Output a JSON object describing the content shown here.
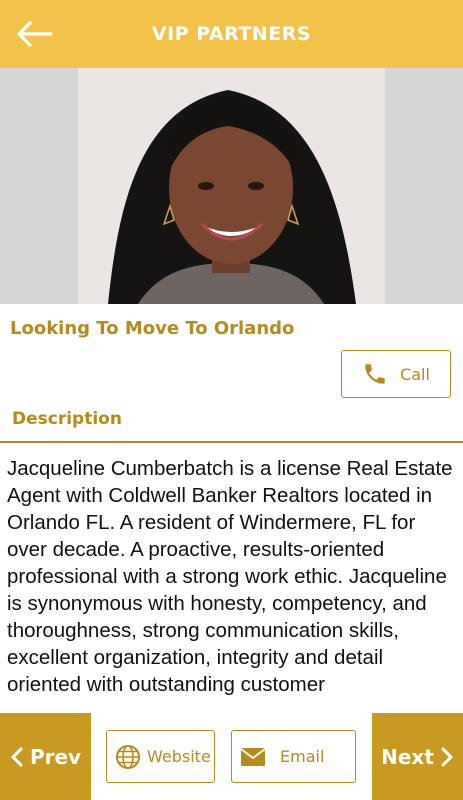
{
  "header": {
    "title": "VIP PARTNERS",
    "back_icon": "arrow-left-icon"
  },
  "profile": {
    "photo_alt": "Partner photo"
  },
  "listing": {
    "title": "Looking To Move To Orlando",
    "call_label": "Call",
    "call_icon": "phone-icon"
  },
  "description": {
    "heading": "Description",
    "text": "Jacqueline Cumberbatch is a license Real Estate Agent with Coldwell Banker Realtors located in Orlando FL.  A resident of Windermere, FL for over decade. A proactive, results-oriented professional with a strong work ethic. Jacqueline is synonymous with honesty, competency, and thoroughness, strong communication skills, excellent organization, integrity and detail oriented with outstanding customer"
  },
  "bottom_nav": {
    "prev_label": "Prev",
    "next_label": "Next",
    "website_label": "Website",
    "email_label": "Email"
  },
  "colors": {
    "header_bg": "#f3c24a",
    "accent": "#b58a1e",
    "nav_button_bg": "#c89a22"
  }
}
